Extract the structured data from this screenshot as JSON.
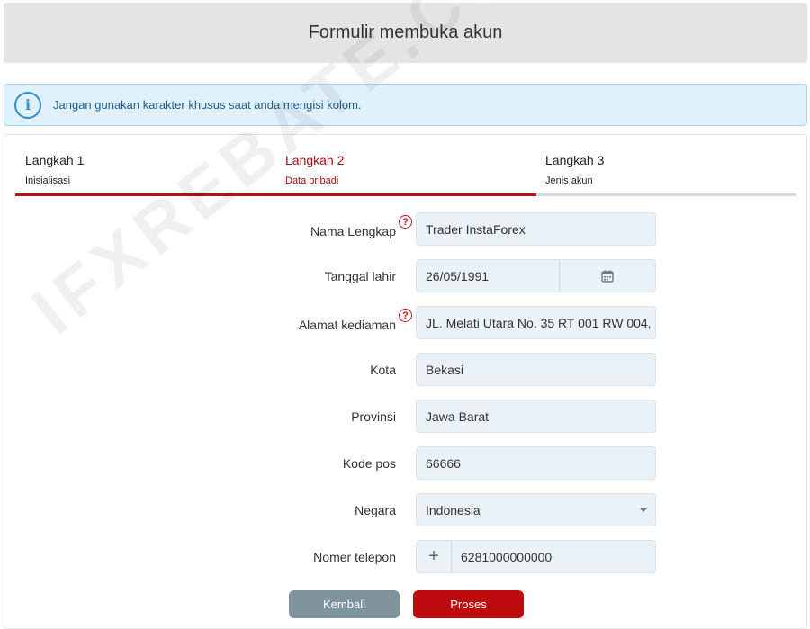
{
  "header": {
    "title": "Formulir membuka akun"
  },
  "notice": {
    "icon": "info-icon",
    "text": "Jangan gunakan karakter khusus saat anda mengisi kolom."
  },
  "steps": [
    {
      "title": "Langkah 1",
      "subtitle": "Inisialisasi",
      "active": false
    },
    {
      "title": "Langkah 2",
      "subtitle": "Data pribadi",
      "active": true
    },
    {
      "title": "Langkah 3",
      "subtitle": "Jenis akun",
      "active": false
    }
  ],
  "progress": {
    "completed_fraction": 0.667,
    "fill_color": "#b80f14"
  },
  "form": {
    "full_name": {
      "label": "Nama Lengkap",
      "value": "Trader InstaForex",
      "help": "?"
    },
    "birth_date": {
      "label": "Tanggal lahir",
      "value": "26/05/1991",
      "icon": "calendar-icon"
    },
    "address": {
      "label": "Alamat kediaman",
      "value": "JL. Melati Utara No. 35 RT 001 RW 004,",
      "help": "?"
    },
    "city": {
      "label": "Kota",
      "value": "Bekasi"
    },
    "province": {
      "label": "Provinsi",
      "value": "Jawa Barat"
    },
    "postal_code": {
      "label": "Kode pos",
      "value": "66666"
    },
    "country": {
      "label": "Negara",
      "value": "Indonesia"
    },
    "phone": {
      "label": "Nomer telepon",
      "prefix": "+",
      "value": "6281000000000"
    }
  },
  "buttons": {
    "back": "Kembali",
    "proceed": "Proses"
  },
  "watermark": "IFXREBATE.COM",
  "colors": {
    "accent": "#bc0a0f",
    "back_button": "#7f939d",
    "info_bg": "#e1f1fc",
    "field_bg": "#eaf2f8"
  }
}
